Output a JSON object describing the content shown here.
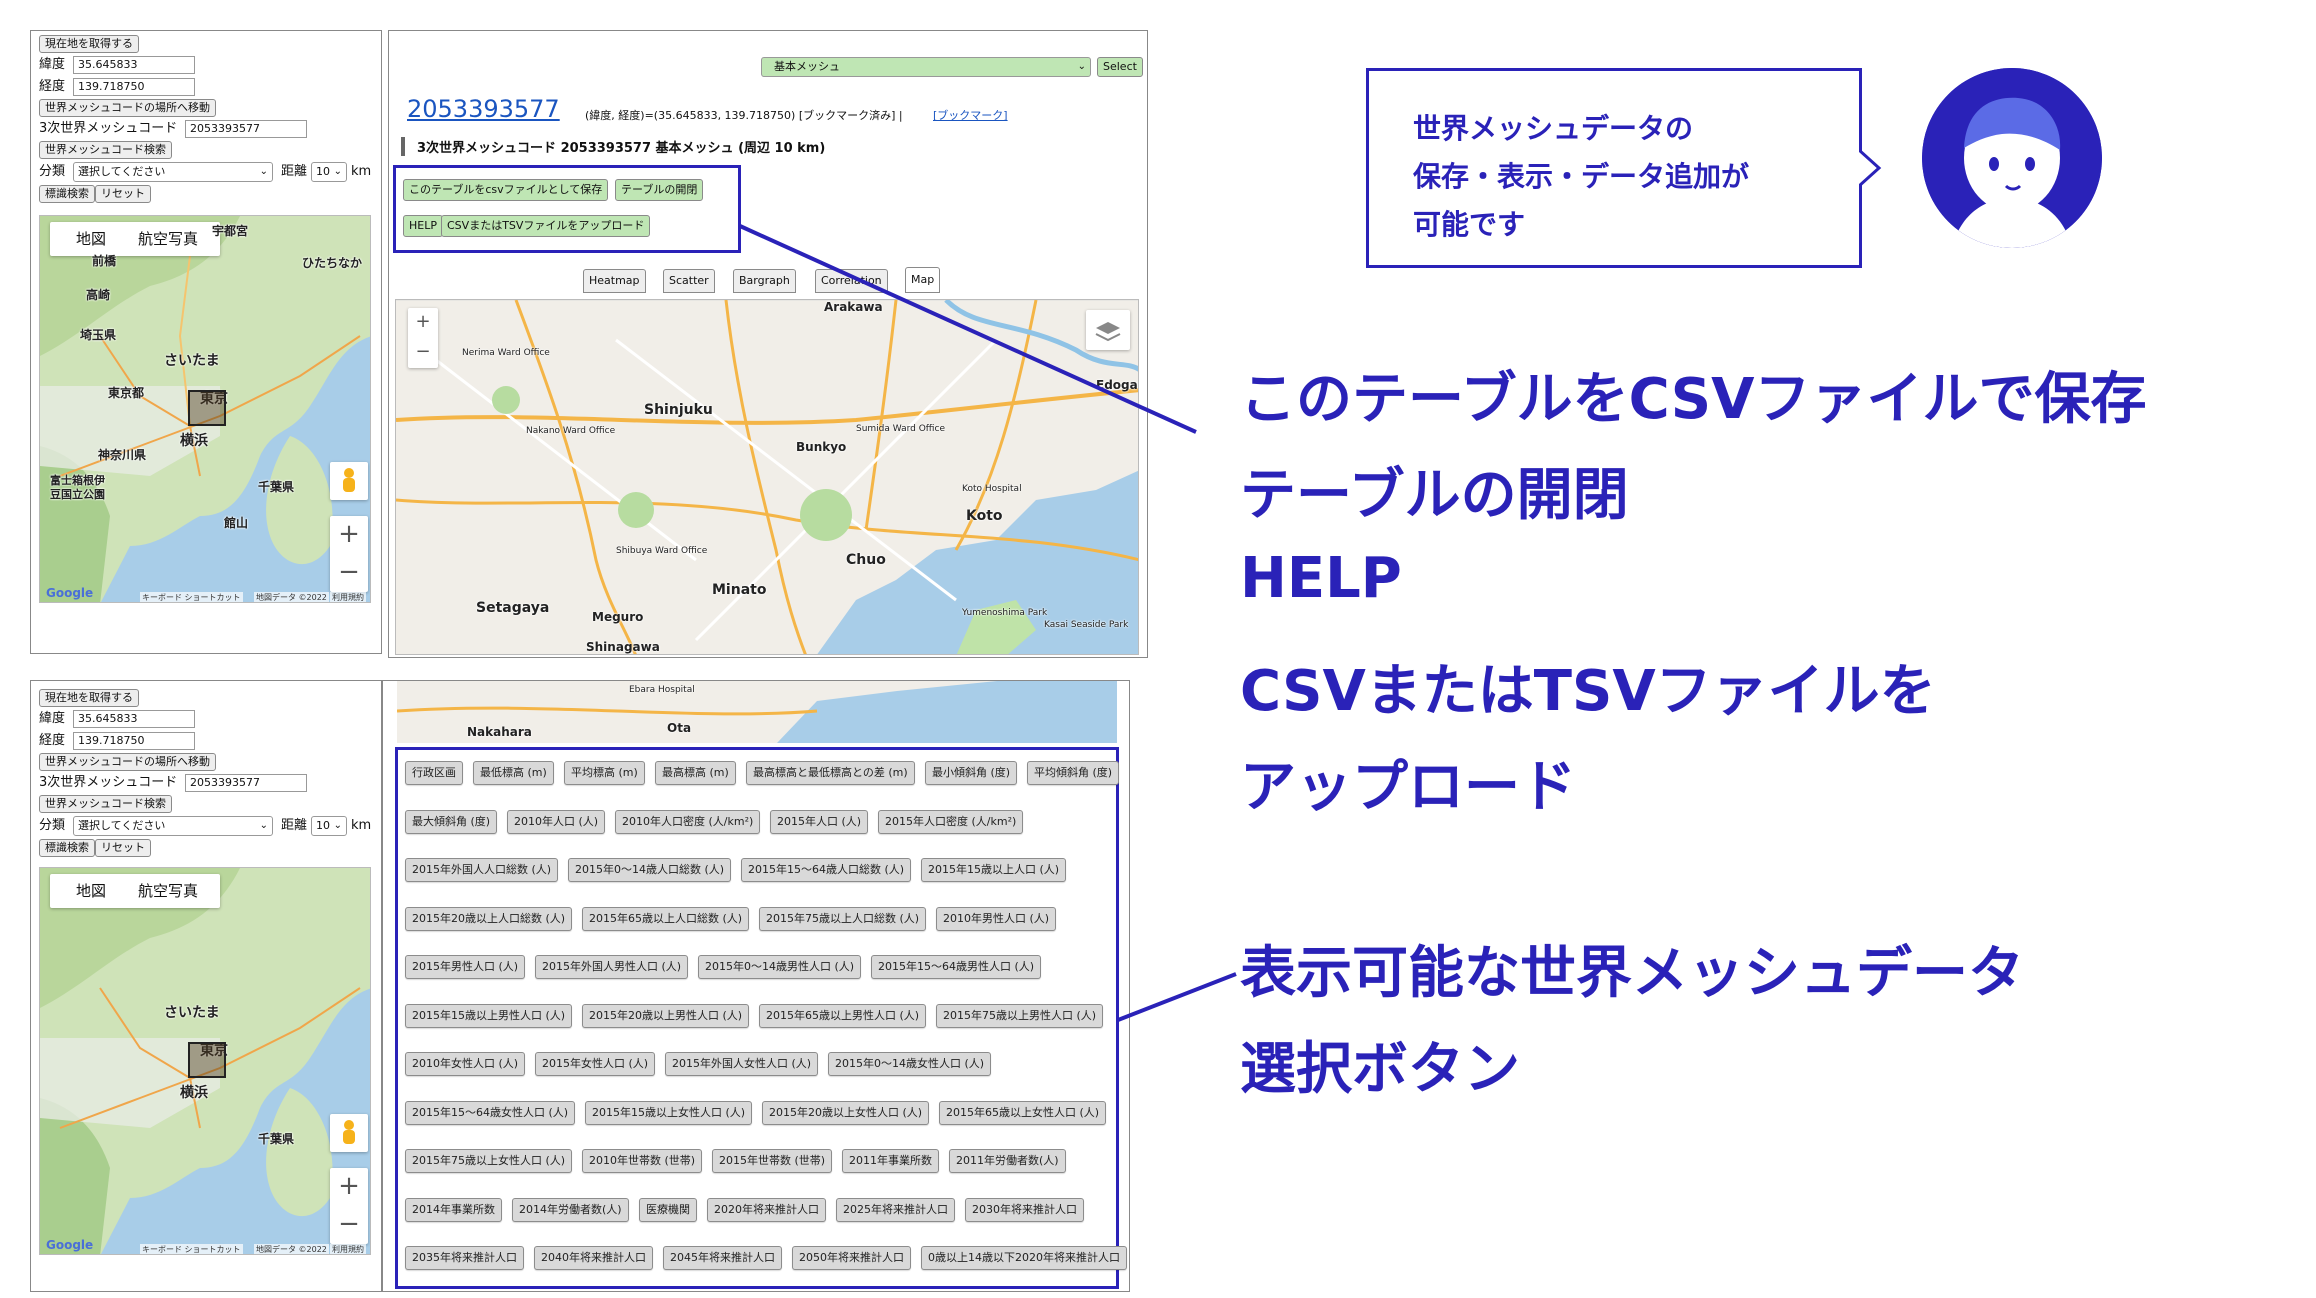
{
  "panel_top": {
    "get_location_label": "現在地を取得する",
    "lat_label": "緯度",
    "lat_value": "35.645833",
    "lon_label": "経度",
    "lon_value": "139.718750",
    "move_to_mesh_label": "世界メッシュコードの場所へ移動",
    "mesh_code_label": "3次世界メッシュコード",
    "mesh_code_value": "2053393577",
    "search_mesh_label": "世界メッシュコード検索",
    "category_label": "分類",
    "category_placeholder": "選択してください",
    "distance_label": "距離",
    "distance_value": "10",
    "km_label": "km",
    "landmark_search_label": "標識検索",
    "reset_label": "リセット",
    "map_tab_map": "地図",
    "map_tab_aerial": "航空写真",
    "map_places": [
      "宇都宮",
      "前橋",
      "高崎",
      "埼玉県",
      "さいたま",
      "東京都",
      "東京",
      "横浜",
      "神奈川県",
      "千葉県",
      "富士箱根伊豆国立公園",
      "館山",
      "ひたちなか"
    ],
    "map_footer_google": "Google",
    "map_footer_shortcuts": "キーボード ショートカット",
    "map_footer_data": "地図データ ©2022",
    "map_footer_terms": "利用規約"
  },
  "panel_bottom": {
    "get_location_label": "現在地を取得する",
    "lat_label": "緯度",
    "lat_value": "35.645833",
    "lon_label": "経度",
    "lon_value": "139.718750",
    "move_to_mesh_label": "世界メッシュコードの場所へ移動",
    "mesh_code_label": "3次世界メッシュコード",
    "mesh_code_value": "2053393577",
    "search_mesh_label": "世界メッシュコード検索",
    "category_label": "分類",
    "category_placeholder": "選択してください",
    "distance_label": "距離",
    "distance_value": "10",
    "km_label": "km",
    "landmark_search_label": "標識検索",
    "reset_label": "リセット",
    "map_tab_map": "地図",
    "map_tab_aerial": "航空写真",
    "map_footer_google": "Google",
    "map_footer_shortcuts": "キーボード ショートカット",
    "map_footer_data": "地図データ ©2022",
    "map_footer_terms": "利用規約"
  },
  "main_top": {
    "mesh_select_value": "基本メッシュ",
    "select_button": "Select",
    "mesh_code_link": "2053393577",
    "coords_text": "(緯度, 経度)=(35.645833, 139.718750) [ブックマーク済み] |",
    "bookmark_link": "[ブックマーク]",
    "heading": "3次世界メッシュコード 2053393577 基本メッシュ (周辺 10 km)",
    "save_csv_button": "このテーブルをcsvファイルとして保存",
    "toggle_table_button": "テーブルの開閉",
    "help_button": "HELP",
    "upload_button": "CSVまたはTSVファイルをアップロード",
    "tabs": [
      "Heatmap",
      "Scatter",
      "Bargraph",
      "Correlation",
      "Map"
    ],
    "map_places": [
      "Arakawa",
      "Shinjuku",
      "Nakano Ward Office",
      "Bunkyo",
      "Sumida Ward Office",
      "Edogawa",
      "Koto",
      "Chuo",
      "Minato",
      "Setagaya",
      "Shibuya Ward Office",
      "Meguro",
      "Shinagawa",
      "Nerima Ward Office",
      "Koto Hospital",
      "Yumenoshima Park",
      "Kasai Seaside Park"
    ]
  },
  "main_bottom": {
    "map_places": [
      "Ebara Hospital",
      "Nakahara",
      "Ota"
    ],
    "data_buttons": [
      [
        "行政区画",
        "最低標高 (m)",
        "平均標高 (m)",
        "最高標高 (m)",
        "最高標高と最低標高との差 (m)",
        "最小傾斜角 (度)",
        "平均傾斜角 (度)"
      ],
      [
        "最大傾斜角 (度)",
        "2010年人口 (人)",
        "2010年人口密度 (人/km²)",
        "2015年人口 (人)",
        "2015年人口密度 (人/km²)"
      ],
      [
        "2015年外国人人口総数 (人)",
        "2015年0〜14歳人口総数 (人)",
        "2015年15〜64歳人口総数 (人)",
        "2015年15歳以上人口 (人)"
      ],
      [
        "2015年20歳以上人口総数 (人)",
        "2015年65歳以上人口総数 (人)",
        "2015年75歳以上人口総数 (人)",
        "2010年男性人口 (人)"
      ],
      [
        "2015年男性人口 (人)",
        "2015年外国人男性人口 (人)",
        "2015年0〜14歳男性人口 (人)",
        "2015年15〜64歳男性人口 (人)"
      ],
      [
        "2015年15歳以上男性人口 (人)",
        "2015年20歳以上男性人口 (人)",
        "2015年65歳以上男性人口 (人)",
        "2015年75歳以上男性人口 (人)"
      ],
      [
        "2010年女性人口 (人)",
        "2015年女性人口 (人)",
        "2015年外国人女性人口 (人)",
        "2015年0〜14歳女性人口 (人)"
      ],
      [
        "2015年15〜64歳女性人口 (人)",
        "2015年15歳以上女性人口 (人)",
        "2015年20歳以上女性人口 (人)",
        "2015年65歳以上女性人口 (人)"
      ],
      [
        "2015年75歳以上女性人口 (人)",
        "2010年世帯数 (世帯)",
        "2015年世帯数 (世帯)",
        "2011年事業所数",
        "2011年労働者数(人)"
      ],
      [
        "2014年事業所数",
        "2014年労働者数(人)",
        "医療機関",
        "2020年将来推計人口",
        "2025年将来推計人口",
        "2030年将来推計人口"
      ],
      [
        "2035年将来推計人口",
        "2040年将来推計人口",
        "2045年将来推計人口",
        "2050年将来推計人口",
        "0歳以上14歳以下2020年将来推計人口"
      ]
    ]
  },
  "annotations": {
    "speech_bubble": [
      "世界メッシュデータの",
      "保存・表示・データ追加が",
      "可能です"
    ],
    "callout_1": [
      "このテーブルをCSVファイルで保存",
      "テーブルの開閉",
      "HELP",
      "CSVまたはTSVファイルを",
      "アップロード"
    ],
    "callout_2": [
      "表示可能な世界メッシュデータ",
      "選択ボタン"
    ],
    "accent_color": "#2a22b8"
  }
}
